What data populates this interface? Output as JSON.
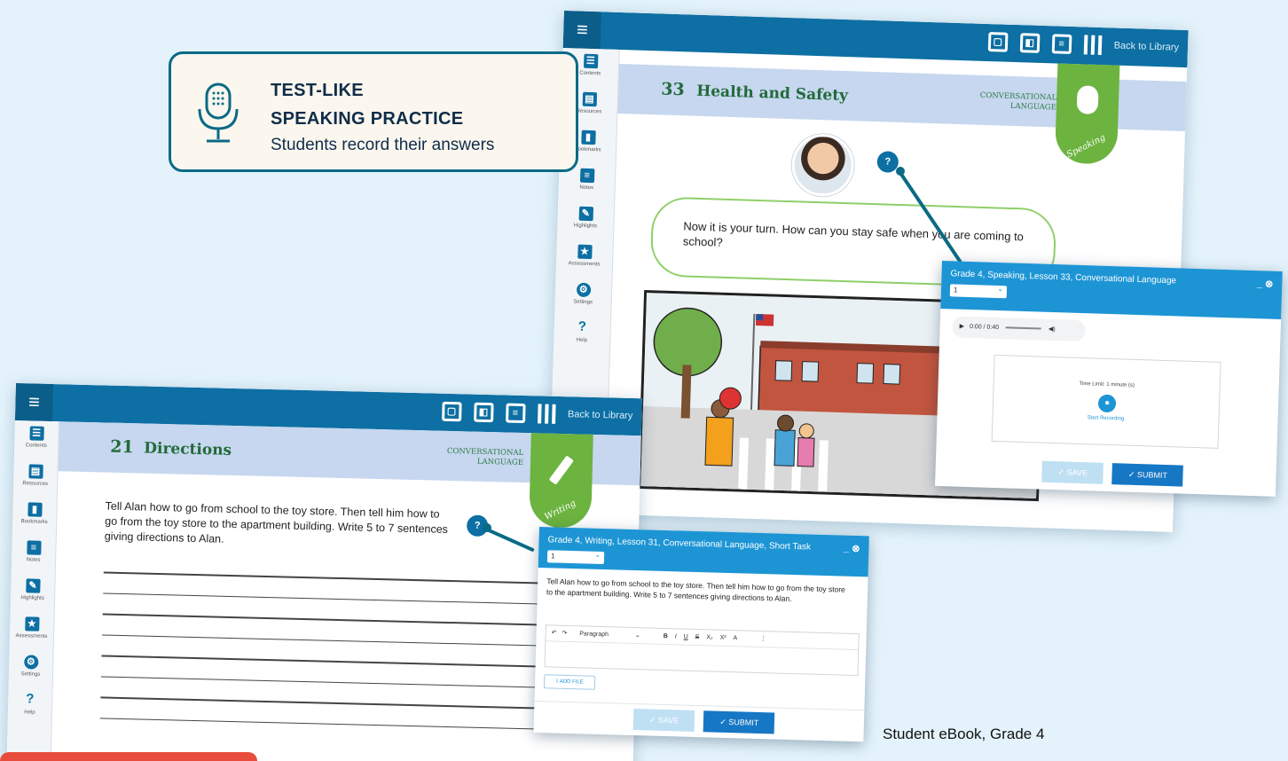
{
  "callout": {
    "line1": "TEST-LIKE",
    "line2": "SPEAKING PRACTICE",
    "line3": "Students record their answers",
    "icon": "microphone-icon"
  },
  "toolbar": {
    "back_label": "Back to Library"
  },
  "sidebar": {
    "items": [
      {
        "label": "Contents"
      },
      {
        "label": "Resources"
      },
      {
        "label": "Bookmarks"
      },
      {
        "label": "Notes"
      },
      {
        "label": "Highlights"
      },
      {
        "label": "Assessments"
      },
      {
        "label": "Settings"
      },
      {
        "label": "Help"
      }
    ]
  },
  "speaking": {
    "lesson_number": "33",
    "lesson_title": "Health and Safety",
    "category_line1": "CONVERSATIONAL",
    "category_line2": "LANGUAGE",
    "ribbon_label": "Speaking",
    "prompt": "Now it is your turn. How can you stay safe when you are coming to school?",
    "panel": {
      "title": "Grade 4, Speaking, Lesson 33, Conversational Language",
      "select_value": "1",
      "audio_time": "0:00 / 0:40",
      "time_limit": "Time Limit: 1 minute (s)",
      "record_label": "Start Recording",
      "save_label": "SAVE",
      "submit_label": "SUBMIT"
    }
  },
  "writing": {
    "lesson_number": "21",
    "lesson_title": "Directions",
    "category_line1": "CONVERSATIONAL",
    "category_line2": "LANGUAGE",
    "ribbon_label": "Writing",
    "prompt": "Tell Alan how to go from school to the toy store. Then tell him how to go from the toy store to the apartment building. Write 5 to 7 sentences giving directions to Alan.",
    "panel": {
      "title": "Grade 4, Writing, Lesson 31, Conversational Language, Short Task",
      "select_value": "1",
      "prompt": "Tell Alan how to go from school to the toy store. Then tell him how to go from the toy store to the apartment building. Write 5 to 7 sentences giving directions to Alan.",
      "format_value": "Paragraph",
      "add_file_label": "ADD FILE",
      "save_label": "SAVE",
      "submit_label": "SUBMIT"
    }
  },
  "caption": "Student eBook, Grade 4",
  "colors": {
    "background": "#e4f3fb",
    "topbar": "#0d6fa3",
    "lesson_band": "#c6d7ef",
    "ribbon": "#6cb33f",
    "panel_header": "#1d95d5"
  }
}
